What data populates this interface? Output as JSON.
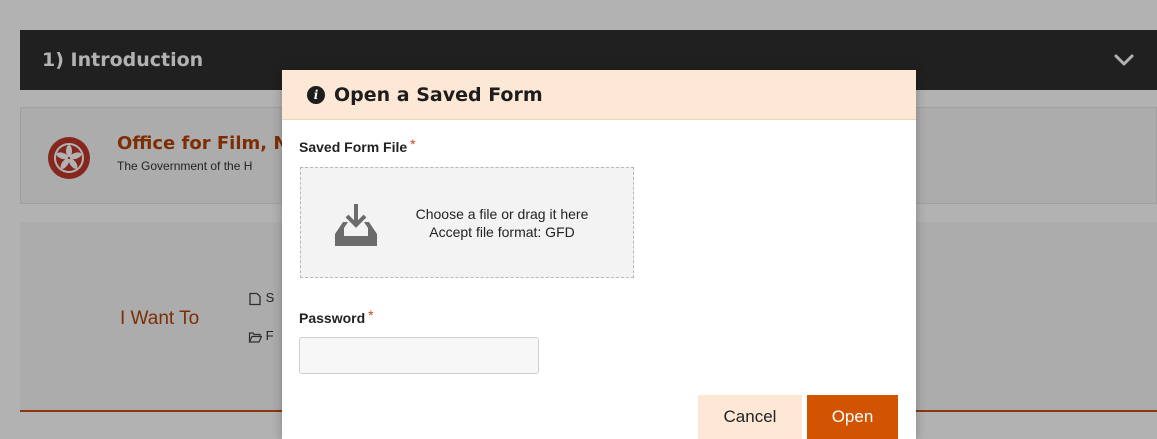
{
  "section": {
    "title": "1) Introduction",
    "chevron_icon": "chevron-down-icon"
  },
  "office": {
    "name": "Office for Film, N",
    "subtitle": "The Government of the H",
    "emblem_icon": "hk-emblem-icon"
  },
  "i_want": {
    "label": "I Want To",
    "options": [
      {
        "icon": "file-icon",
        "text": "S"
      },
      {
        "icon": "folder-open-icon",
        "text": "F"
      }
    ]
  },
  "modal": {
    "title": "Open a Saved Form",
    "saved_file_label": "Saved Form File",
    "required_mark": "*",
    "dropzone": {
      "line1": "Choose a file or drag it here",
      "line2": "Accept file format: GFD",
      "icon": "download-tray-icon"
    },
    "password_label": "Password",
    "password_value": "",
    "cancel_label": "Cancel",
    "open_label": "Open"
  },
  "colors": {
    "accent": "#d35400",
    "header_bg": "#2e2e2e",
    "modal_header_bg": "#fde8d6",
    "brand_text": "#b2440a"
  }
}
